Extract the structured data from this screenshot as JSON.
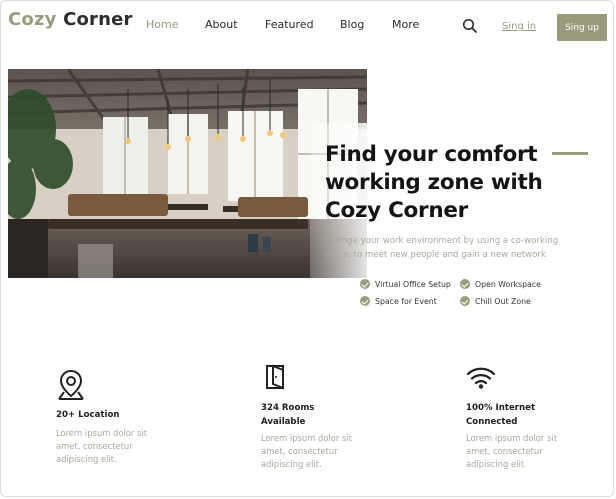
{
  "brand": {
    "name_part1": "Cozy",
    "name_part2": "Corner"
  },
  "nav": {
    "items": [
      "Home",
      "About",
      "Featured",
      "Blog",
      "More"
    ],
    "active": "Home"
  },
  "header": {
    "signin_label": "Sing in",
    "signup_label": "Sing up",
    "search_icon": "search-icon"
  },
  "hero": {
    "headline_lines": [
      "Find your comfort",
      "working zone with",
      "Cozy Corner"
    ],
    "subtext_lines": [
      "Change your work environment by using a co-working",
      "place, to meet new people and gain a new network"
    ],
    "features": [
      "Virtual Office Setup",
      "Open Workspace",
      "Space for Event",
      "Chill Out Zone"
    ]
  },
  "stats": [
    {
      "icon": "location-pin-icon",
      "title_lines": [
        "20+ Location"
      ],
      "desc_lines": [
        "Lorem ipsum dolor sit",
        "amet, consectetur",
        "adipiscing elit."
      ]
    },
    {
      "icon": "door-icon",
      "title_lines": [
        "324 Rooms",
        "Available"
      ],
      "desc_lines": [
        "Lorem ipsum dolor sit",
        "amet, consectetur",
        "adipiscing elit."
      ]
    },
    {
      "icon": "wifi-icon",
      "title_lines": [
        "100% Internet",
        "Connected"
      ],
      "desc_lines": [
        "Lorem ipsum dolor sit",
        "amet, consectetur",
        "adipiscing elit."
      ]
    }
  ],
  "colors": {
    "accent": "#9a9a7c",
    "text_dark": "#1f1f1f",
    "text_muted": "#a8a89a"
  }
}
